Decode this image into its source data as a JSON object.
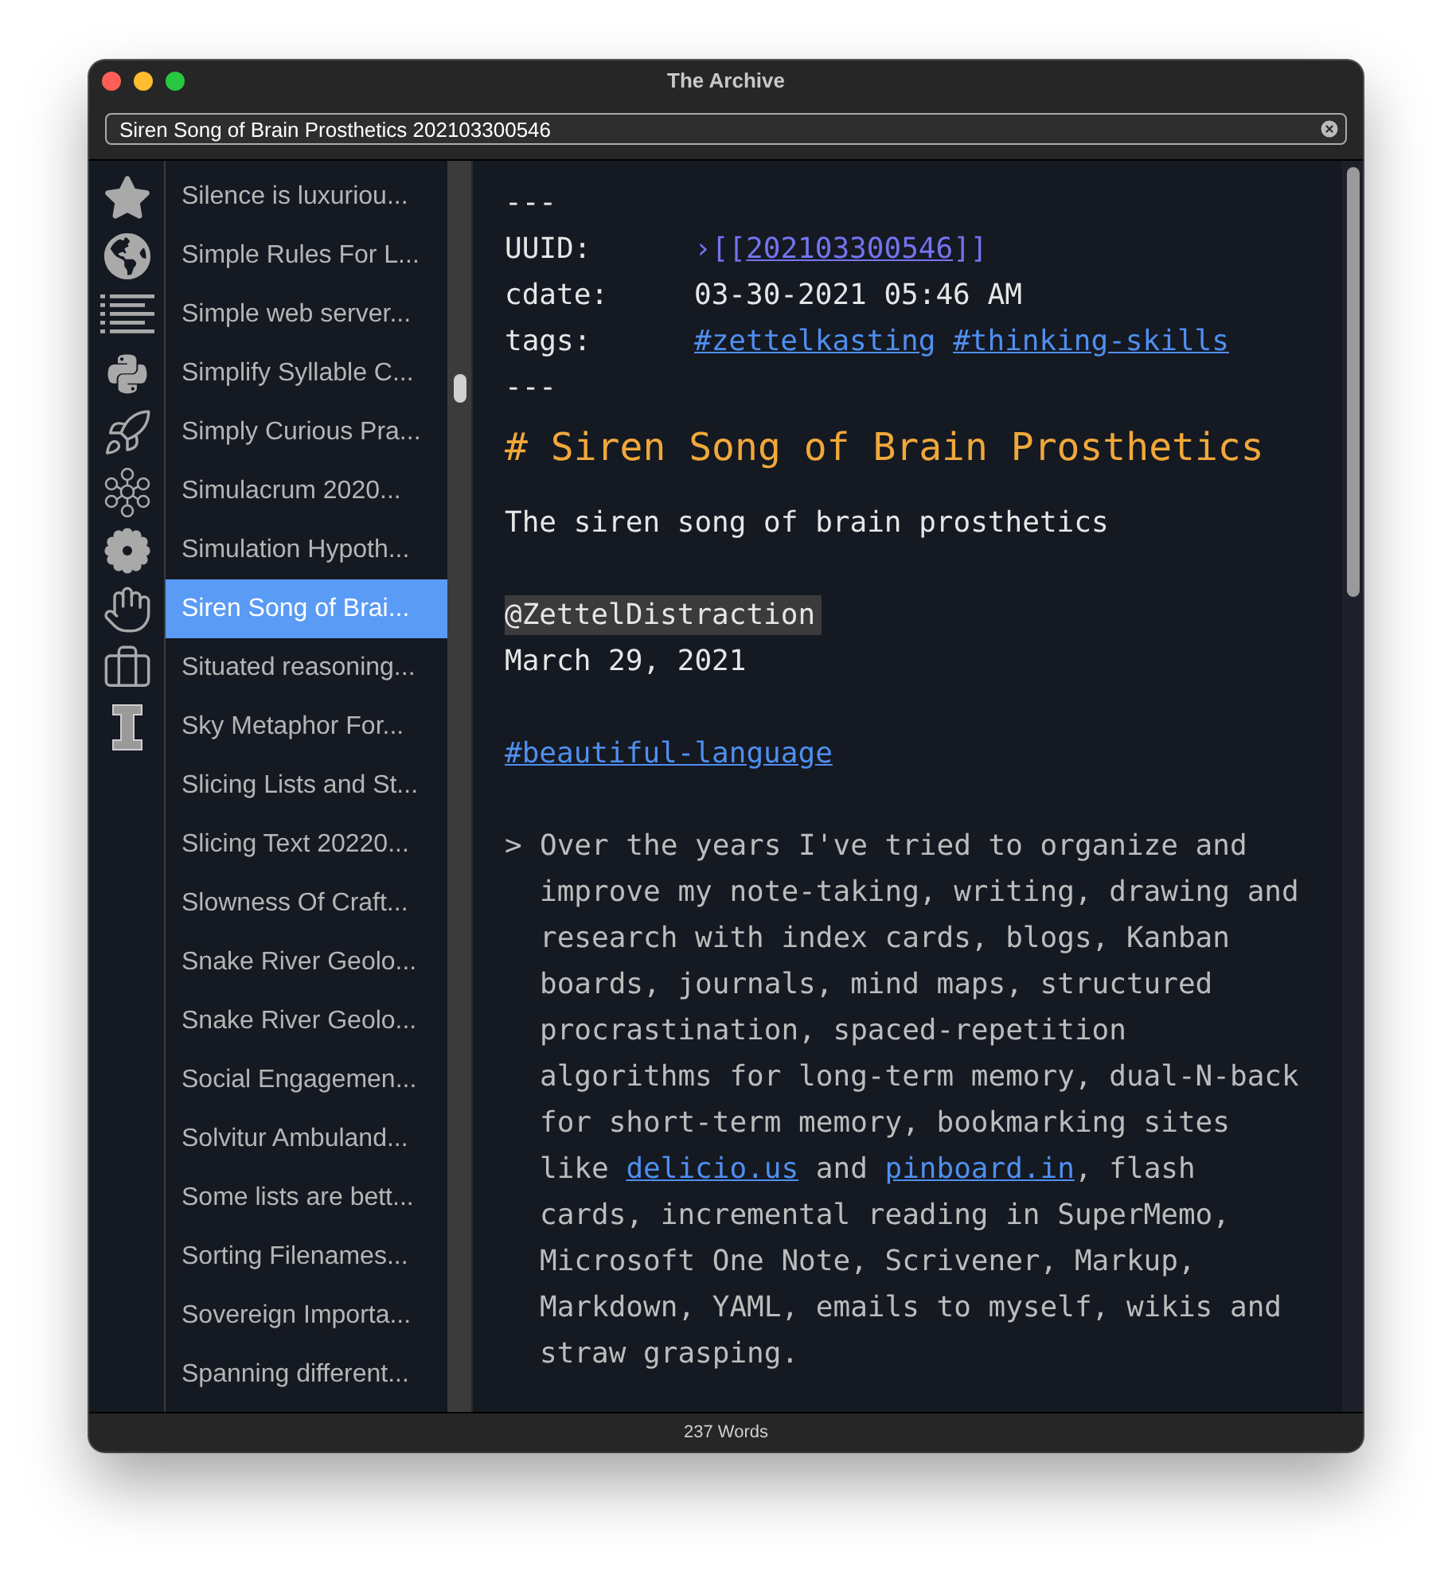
{
  "window": {
    "title": "The Archive"
  },
  "search": {
    "value": "Siren Song of Brain Prosthetics 202103300546"
  },
  "notes": [
    {
      "title": "Silence is luxuriou...",
      "selected": false
    },
    {
      "title": "Simple Rules For L...",
      "selected": false
    },
    {
      "title": "Simple web server...",
      "selected": false
    },
    {
      "title": "Simplify Syllable C...",
      "selected": false
    },
    {
      "title": "Simply Curious Pra...",
      "selected": false
    },
    {
      "title": "Simulacrum 2020...",
      "selected": false
    },
    {
      "title": "Simulation Hypoth...",
      "selected": false
    },
    {
      "title": "Siren Song of Brai...",
      "selected": true
    },
    {
      "title": "Situated reasoning...",
      "selected": false
    },
    {
      "title": "Sky Metaphor For...",
      "selected": false
    },
    {
      "title": "Slicing Lists and St...",
      "selected": false
    },
    {
      "title": "Slicing Text 20220...",
      "selected": false
    },
    {
      "title": "Slowness Of Craft...",
      "selected": false
    },
    {
      "title": "Snake River Geolo...",
      "selected": false
    },
    {
      "title": "Snake River Geolo...",
      "selected": false
    },
    {
      "title": "Social Engagemen...",
      "selected": false
    },
    {
      "title": "Solvitur Ambuland...",
      "selected": false
    },
    {
      "title": "Some lists are bett...",
      "selected": false
    },
    {
      "title": "Sorting Filenames...",
      "selected": false
    },
    {
      "title": "Sovereign Importa...",
      "selected": false
    },
    {
      "title": "Spanning different...",
      "selected": false
    }
  ],
  "editor": {
    "front_matter_open": "---",
    "front_matter": [
      {
        "kind": "wikilink",
        "key": "UUID:",
        "chevron": "›",
        "open": "[[",
        "link": "202103300546",
        "close": "]]"
      },
      {
        "kind": "text",
        "key": "cdate:",
        "value": "03-30-2021 05:46 AM"
      },
      {
        "kind": "tags",
        "key": "tags:",
        "tags": [
          "#zettelkasting",
          "#thinking-skills"
        ]
      }
    ],
    "front_matter_close": "---",
    "blocks": [
      {
        "kind": "heading",
        "text": "# Siren Song of Brain Prosthetics"
      },
      {
        "kind": "text",
        "text": "The siren song of brain prosthetics"
      },
      {
        "kind": "attribution",
        "mention": "@ZettelDistraction",
        "date": "March 29, 2021"
      },
      {
        "kind": "tag",
        "text": "#beautiful-language"
      },
      {
        "kind": "quote",
        "marker": ">",
        "parts": [
          {
            "kind": "text",
            "text": "Over the years I've tried to organize and improve my note-taking, writing, drawing and research with index cards, blogs, Kanban boards, journals, mind maps, structured procrastination, spaced-repetition algorithms for long-term memory, dual-N-back for short-term memory, bookmarking sites like "
          },
          {
            "kind": "link",
            "text": "delicio.us"
          },
          {
            "kind": "text",
            "text": " and "
          },
          {
            "kind": "link",
            "text": "pinboard.in"
          },
          {
            "kind": "text",
            "text": ", flash cards, incremental reading in SuperMemo, Microsoft One Note, Scrivener, Markup, Markdown, YAML, emails to myself, wikis and straw grasping."
          }
        ]
      }
    ]
  },
  "status_bar": {
    "text": "237 Words"
  }
}
